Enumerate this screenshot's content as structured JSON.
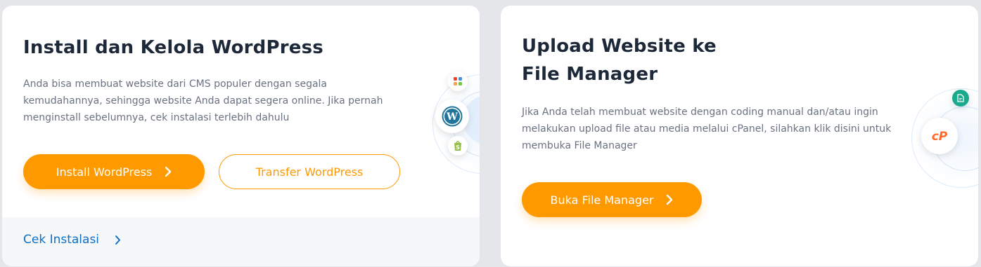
{
  "wordpress_card": {
    "title": "Install dan Kelola WordPress",
    "description_lines": [
      "Anda bisa membuat website dari CMS populer dengan segala",
      "kemudahannya, sehingga website Anda dapat segera online. Jika pernah",
      "menginstall sebelumnya, cek instalasi terlebih dahulu"
    ],
    "install_button_label": "Install WordPress",
    "transfer_button_label": "Transfer WordPress",
    "check_link_label": "Cek Instalasi"
  },
  "file_manager_card": {
    "title_lines": [
      "Upload Website ke",
      "File Manager"
    ],
    "description_lines": [
      "Jika Anda telah membuat website dengan coding manual dan/atau ingin",
      "melakukan upload file atau media melalui cPanel, silahkan klik disini untuk",
      "membuka File Manager"
    ],
    "open_button_label": "Buka File Manager"
  },
  "colors": {
    "accent": "#ff9900",
    "link": "#0c70c7",
    "title": "#1d2939",
    "body_text": "#6a7180",
    "wordpress_blue": "#21759b",
    "cpanel_orange": "#ff6c2c",
    "file_badge_green": "#1aaa8c"
  },
  "icons": [
    "joomla-icon",
    "wordpress-icon",
    "shopify-icon",
    "chevron-right-icon",
    "cpanel-icon",
    "file-icon"
  ]
}
